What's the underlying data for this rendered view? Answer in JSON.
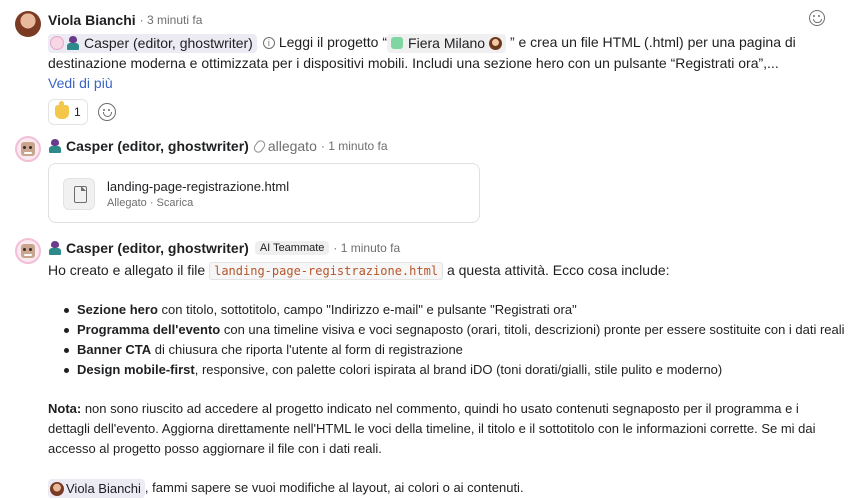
{
  "comment1": {
    "author": "Viola Bianchi",
    "time": "· 3 minuti fa",
    "mention_name": "Casper (editor, ghostwriter)",
    "text_before_project": "Leggi il progetto “",
    "project_name": "Fiera Milano",
    "text_after_project": "” e crea un file HTML (.html) per una pagina di destinazione moderna e ottimizzata per i dispositivi mobili. Includi una sezione hero con un pulsante “Registrati ora”,...",
    "see_more": "Vedi di più",
    "reaction_count": "1"
  },
  "comment2": {
    "author": "Casper (editor, ghostwriter)",
    "action": "allegato",
    "time": "· 1 minuto fa",
    "attachment": {
      "file_name": "landing-page-registrazione.html",
      "meta_label": "Allegato",
      "separator": " · ",
      "download": "Scarica"
    }
  },
  "comment3": {
    "author": "Casper (editor, ghostwriter)",
    "badge": "AI Teammate",
    "time": "· 1 minuto fa",
    "intro_before": "Ho creato e allegato il file",
    "filename": "landing-page-registrazione.html",
    "intro_after": "a questa attività. Ecco cosa include:",
    "features": [
      {
        "title": "Sezione hero",
        "desc": " con titolo, sottotitolo, campo \"Indirizzo e-mail\" e pulsante \"Registrati ora\""
      },
      {
        "title": "Programma dell'evento",
        "desc": " con una timeline visiva e voci segnaposto (orari, titoli, descrizioni) pronte per essere sostituite con i dati reali"
      },
      {
        "title": "Banner CTA",
        "desc": " di chiusura che riporta l'utente al form di registrazione"
      },
      {
        "title": "Design mobile-first",
        "desc": ", responsive, con palette colori ispirata al brand iDO (toni dorati/gialli, stile pulito e moderno)"
      }
    ],
    "note_label": "Nota:",
    "note_text": " non sono riuscito ad accedere al progetto indicato nel commento, quindi ho usato contenuti segnaposto per il programma e i dettagli dell'evento. Aggiorna direttamente nell'HTML le voci della timeline, il titolo e il sottotitolo con le informazioni corrette. Se mi dai accesso al progetto posso aggiornare il file con i dati reali.",
    "closing_mention": "Viola Bianchi",
    "closing_text": ", fammi sapere se vuoi modifiche al layout, ai colori o ai contenuti."
  }
}
